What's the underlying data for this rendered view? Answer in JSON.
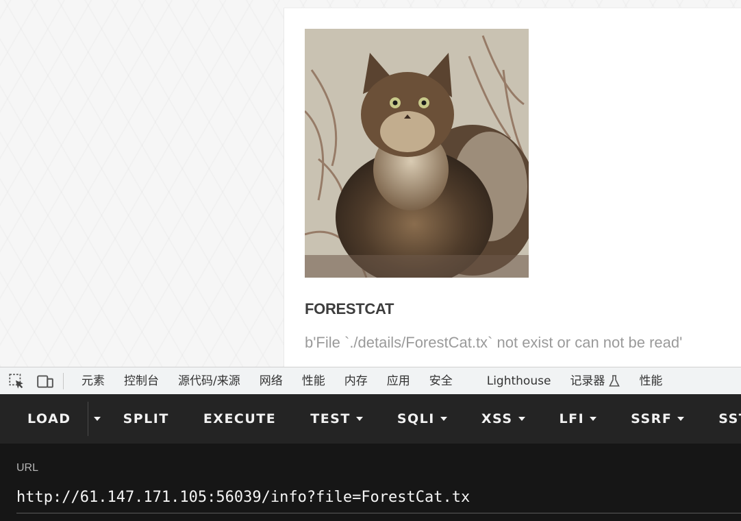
{
  "product": {
    "name": "FORESTCAT",
    "detail_text": "b'File `./details/ForestCat.tx` not exist or can not be read'",
    "image_icon": "forest-cat-photo"
  },
  "devtools": {
    "tabs": [
      {
        "label": "元素"
      },
      {
        "label": "控制台"
      },
      {
        "label": "源代码/来源"
      },
      {
        "label": "网络"
      },
      {
        "label": "性能"
      },
      {
        "label": "内存"
      },
      {
        "label": "应用"
      },
      {
        "label": "安全"
      },
      {
        "label": "Lighthouse"
      },
      {
        "label": "记录器"
      },
      {
        "label": "性能"
      }
    ],
    "icons": [
      "inspect-element-icon",
      "device-toolbar-icon",
      "flask-icon"
    ]
  },
  "hackbar": {
    "buttons": [
      {
        "label": "LOAD"
      },
      {
        "label": "SPLIT"
      },
      {
        "label": "EXECUTE"
      },
      {
        "label": "TEST"
      },
      {
        "label": "SQLI"
      },
      {
        "label": "XSS"
      },
      {
        "label": "LFI"
      },
      {
        "label": "SSRF"
      },
      {
        "label": "SSTI"
      }
    ]
  },
  "url_panel": {
    "label": "URL",
    "value": "http://61.147.171.105:56039/info?file=ForestCat.tx"
  },
  "colors": {
    "hackbar_bg": "#242424",
    "url_panel_bg": "#161616",
    "devtools_bar_bg": "#f1f3f4"
  }
}
